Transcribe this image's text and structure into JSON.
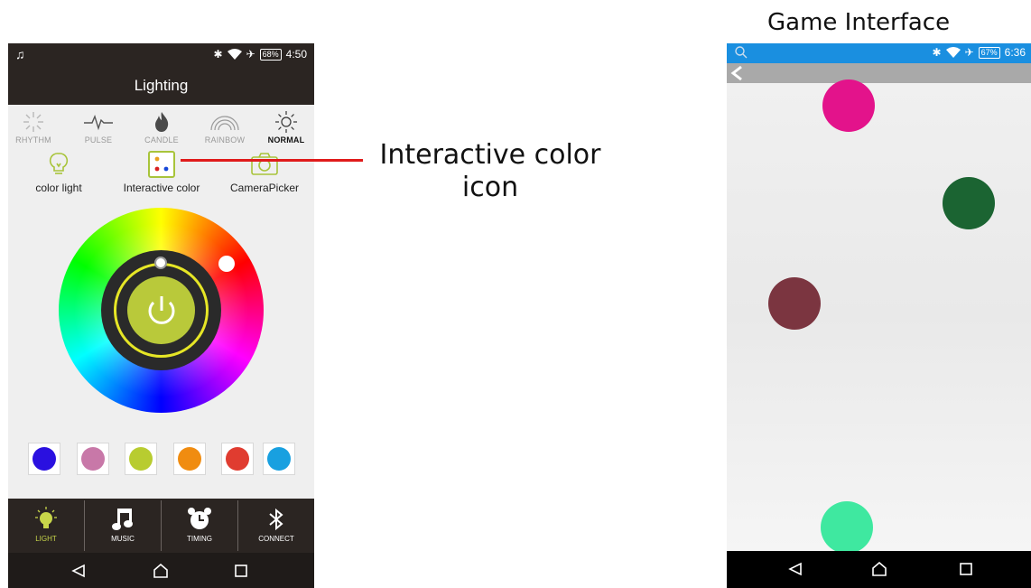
{
  "left_phone": {
    "status": {
      "time": "4:50",
      "battery": "68%"
    },
    "title": "Lighting",
    "modes": [
      {
        "label": "RHYTHM",
        "icon": "sparkle-icon",
        "active": false
      },
      {
        "label": "PULSE",
        "icon": "pulse-icon",
        "active": false
      },
      {
        "label": "CANDLE",
        "icon": "flame-icon",
        "active": false
      },
      {
        "label": "RAINBOW",
        "icon": "rainbow-icon",
        "active": false
      },
      {
        "label": "NORMAL",
        "icon": "sun-icon",
        "active": true
      }
    ],
    "tools": [
      {
        "label": "color light",
        "icon": "bulb-icon"
      },
      {
        "label": "Interactive color",
        "icon": "interactive-color-icon"
      },
      {
        "label": "CameraPicker",
        "icon": "camera-icon"
      }
    ],
    "swatches": [
      "#2a10e0",
      "#c878a8",
      "#b8cc30",
      "#f08c10",
      "#e03c30",
      "#18a0e0"
    ],
    "bottom_nav": [
      {
        "label": "LIGHT",
        "icon": "bulb-icon",
        "active": true
      },
      {
        "label": "MUSIC",
        "icon": "music-note-icon",
        "active": false
      },
      {
        "label": "TIMING",
        "icon": "alarm-clock-icon",
        "active": false
      },
      {
        "label": "CONNECT",
        "icon": "bluetooth-icon",
        "active": false
      }
    ]
  },
  "annotation": {
    "callout_line1": "Interactive color",
    "callout_line2": "icon",
    "right_caption": "Game Interface"
  },
  "right_phone": {
    "status": {
      "time": "6:36",
      "battery": "67%"
    },
    "balls": [
      "#e3138b",
      "#1b6432",
      "#7b3540",
      "#3fe8a0"
    ]
  },
  "colors": {
    "accent": "#c8d64a",
    "callout": "#e01b1b",
    "status_blue": "#1a8fe0"
  }
}
